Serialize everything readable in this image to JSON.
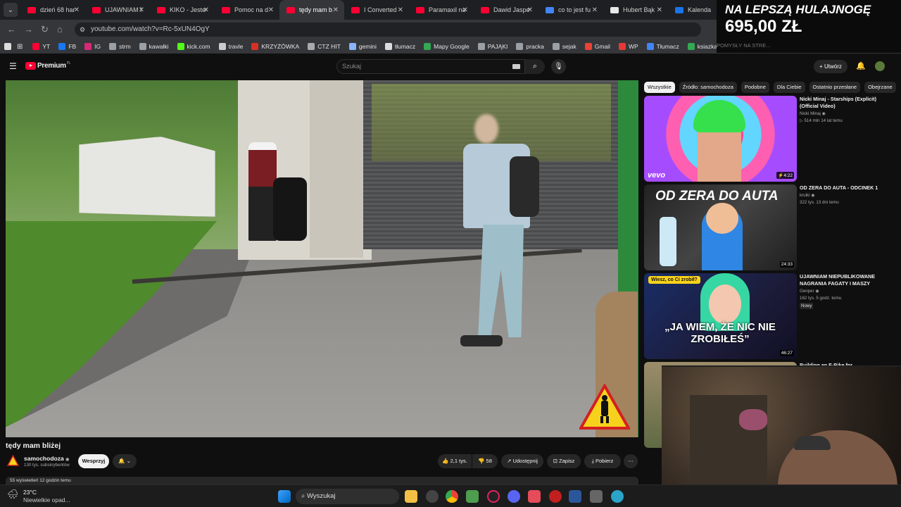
{
  "browser": {
    "tabs": [
      {
        "label": "dzień 68 har",
        "color": "#ff0033",
        "active": false
      },
      {
        "label": "UJAWNIAM N",
        "color": "#ff0033",
        "active": false
      },
      {
        "label": "KIKO - Jestem",
        "color": "#ff0033",
        "active": false
      },
      {
        "label": "Pomoc na d",
        "color": "#ff0033",
        "active": false
      },
      {
        "label": "tędy mam b",
        "color": "#ff0033",
        "active": true
      },
      {
        "label": "I Converted",
        "color": "#ff0033",
        "active": false
      },
      {
        "label": "Paramaxil na",
        "color": "#ff0033",
        "active": false
      },
      {
        "label": "Dawid Jaspe",
        "color": "#ff0033",
        "active": false
      },
      {
        "label": "co to jest fu",
        "color": "#4285f4",
        "active": false
      },
      {
        "label": "Hubert Bąk",
        "color": "#e8e8e8",
        "active": false
      },
      {
        "label": "Kalenda",
        "color": "#1a73e8",
        "active": false
      }
    ],
    "url": "youtube.com/watch?v=Rc-5xUN4OgY",
    "bookmarks": [
      {
        "label": "YT",
        "color": "#ff0033"
      },
      {
        "label": "FB",
        "color": "#1877f2"
      },
      {
        "label": "IG",
        "color": "#d62976"
      },
      {
        "label": "strm",
        "color": "#9aa0a6"
      },
      {
        "label": "kawałki",
        "color": "#9aa0a6"
      },
      {
        "label": "kick.com",
        "color": "#53fc18"
      },
      {
        "label": "travle",
        "color": "#cccccc"
      },
      {
        "label": "KRZYŻÓWKA",
        "color": "#d93025"
      },
      {
        "label": "CTZ HIT",
        "color": "#aaaaaa"
      },
      {
        "label": "gemini",
        "color": "#8ab4f8"
      },
      {
        "label": "tłumacz",
        "color": "#dddddd"
      },
      {
        "label": "Mapy Google",
        "color": "#34a853"
      },
      {
        "label": "PAJĄKI",
        "color": "#9aa0a6"
      },
      {
        "label": "pracka",
        "color": "#9aa0a6"
      },
      {
        "label": "sejak",
        "color": "#9aa0a6"
      },
      {
        "label": "Gmail",
        "color": "#ea4335"
      },
      {
        "label": "WP",
        "color": "#e53935"
      },
      {
        "label": "Tłumacz",
        "color": "#4285f4"
      },
      {
        "label": "ksiazka",
        "color": "#34a853"
      }
    ]
  },
  "youtube": {
    "logo": "Premium",
    "logo_suffix": "PL",
    "search_placeholder": "Szukaj",
    "create_label": "Utwórz",
    "chips": [
      "Wszystkie",
      "Źródło: samochodoza",
      "Podobne",
      "Dla Ciebie",
      "Ostatnio przesłane",
      "Obejrzane"
    ],
    "video": {
      "title": "tędy mam bliżej",
      "channel": "samochodoza",
      "subscribers": "130 tys. subskrybentów",
      "support_label": "Wesprzyj",
      "likes": "2,1 tys.",
      "dislikes": "58",
      "share_label": "Udostępnij",
      "save_label": "Zapisz",
      "download_label": "Pobierz",
      "views_line": "55 wyświetleń  12 godzin temu"
    },
    "recommendations": [
      {
        "title": "Nicki Minaj - Starships (Explicit) (Official Video)",
        "channel": "Nicki Minaj",
        "meta": "514 mln  14 lat temu",
        "duration": "4:22",
        "badge": "vevo",
        "thumb_text": ""
      },
      {
        "title": "OD ZERA DO AUTA - ODCINEK 1",
        "channel": "krulki",
        "meta": "322 tys.  13 dni temu",
        "duration": "24:33",
        "badge": "",
        "thumb_text": "OD ZERA DO AUTA"
      },
      {
        "title": "UJAWNIAM NIEPUBLIKOWANE NAGRANIA FAGATY I MASZY",
        "channel": "Genper",
        "meta": "162 tys.  5 godz. temu",
        "duration": "46:27",
        "badge": "Nowy",
        "thumb_text": "„JA WIEM, ŻE NIC NIE ZROBIŁEŚ”",
        "thumb_sticker": "Wiesz, co Ci zrobił?"
      },
      {
        "title": "Building an E-Bike for Abandoned",
        "channel": "",
        "meta": "",
        "duration": "",
        "badge": "",
        "thumb_text": ""
      }
    ]
  },
  "promo": {
    "line1": "NA LEPSZĄ HULAJNOGĘ",
    "line2": "695,00 ZŁ",
    "line3": "POMYSŁY NA STRE..."
  },
  "taskbar": {
    "temperature": "23°C",
    "weather": "Niewielkie opad...",
    "search_label": "Wyszukaj"
  }
}
